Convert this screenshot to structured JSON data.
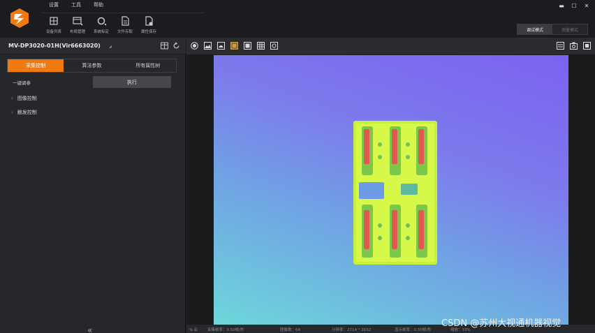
{
  "menu": {
    "items": [
      "设置",
      "工具",
      "帮助"
    ]
  },
  "toolbar": [
    {
      "label": "设备列表",
      "icon": "device-list-icon"
    },
    {
      "label": "布局管理",
      "icon": "layout-icon"
    },
    {
      "label": "系统标定",
      "icon": "calibration-icon"
    },
    {
      "label": "文件存取",
      "icon": "file-icon"
    },
    {
      "label": "属性保存",
      "icon": "save-props-icon"
    }
  ],
  "modes": {
    "debug": "调试模式",
    "measure": "测量模式"
  },
  "device": {
    "name": "MV-DP3020-01H(Vir6663020)"
  },
  "tabs": [
    {
      "label": "采集控制",
      "active": true
    },
    {
      "label": "算法参数",
      "active": false
    },
    {
      "label": "所有属性树",
      "active": false
    }
  ],
  "props": {
    "one_click": "一键调参",
    "execute": "执行"
  },
  "groups": [
    "图像控制",
    "触发控制"
  ],
  "statusbar": {
    "rate": "采集帧率：0.50帧/秒",
    "images": "图像数：64",
    "resolution": "分辨率：2714 * 2032",
    "display": "显示帧率：0.50帧/秒",
    "zoom": "缩放：33%"
  },
  "watermark": "CSDN @苏州大视通机器视觉",
  "colors": {
    "accent": "#f07a10",
    "panel": "#26272b",
    "canvas": "#1a1b1d"
  }
}
